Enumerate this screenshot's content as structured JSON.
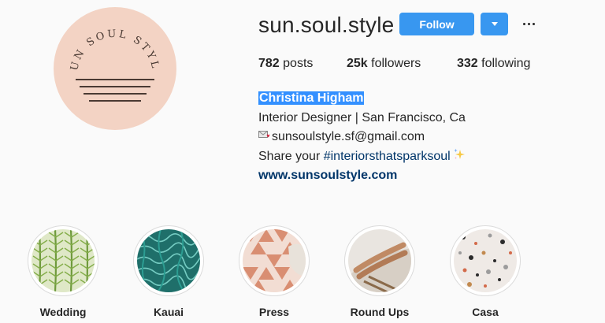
{
  "profile": {
    "username": "sun.soul.style",
    "logo_text": "SUN SOUL STYLE",
    "follow_label": "Follow",
    "stats": {
      "posts_count": "782",
      "posts_label": "posts",
      "followers_count": "25k",
      "followers_label": "followers",
      "following_count": "332",
      "following_label": "following"
    },
    "bio": {
      "full_name": "Christina Higham",
      "occupation": "Interior Designer | San Francisco, Ca",
      "email": "sunsoulstyle.sf@gmail.com",
      "share_prefix": "Share your ",
      "hashtag": "#interiorsthatsparksoul",
      "website": "www.sunsoulstyle.com"
    }
  },
  "highlights": [
    {
      "label": "Wedding",
      "icon": "palm-leaf-pattern"
    },
    {
      "label": "Kauai",
      "icon": "pool-water"
    },
    {
      "label": "Press",
      "icon": "geometric-tile"
    },
    {
      "label": "Round Ups",
      "icon": "legs-on-chair"
    },
    {
      "label": "Casa",
      "icon": "terrazzo"
    }
  ],
  "colors": {
    "accent": "#3897f0",
    "logo_bg": "#f3d3c4",
    "logo_ink": "#4a3a33",
    "link": "#003569",
    "selection": "#3390ff"
  }
}
